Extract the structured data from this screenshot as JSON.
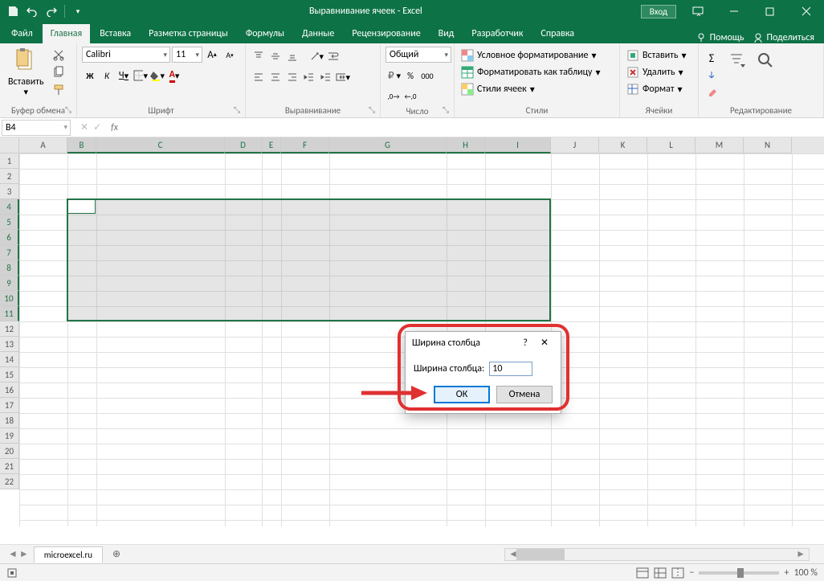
{
  "titlebar": {
    "title": "Выравнивание ячеек - Excel",
    "account": "Вход"
  },
  "tabs": {
    "file": "Файл",
    "home": "Главная",
    "insert": "Вставка",
    "layout": "Разметка страницы",
    "formulas": "Формулы",
    "data": "Данные",
    "review": "Рецензирование",
    "view": "Вид",
    "developer": "Разработчик",
    "help": "Справка",
    "tell": "Помощь",
    "share": "Поделиться"
  },
  "ribbon": {
    "clipboard": {
      "label": "Буфер обмена",
      "paste": "Вставить"
    },
    "font": {
      "label": "Шрифт",
      "family": "Calibri",
      "size": "11",
      "bold": "Ж",
      "italic": "К",
      "underline": "Ч"
    },
    "align": {
      "label": "Выравнивание"
    },
    "number": {
      "label": "Число",
      "format": "Общий"
    },
    "styles": {
      "label": "Стили",
      "cond": "Условное форматирование",
      "table": "Форматировать как таблицу",
      "cell": "Стили ячеек"
    },
    "cells": {
      "label": "Ячейки",
      "insert": "Вставить",
      "delete": "Удалить",
      "format": "Формат"
    },
    "editing": {
      "label": "Редактирование"
    }
  },
  "namebox": "B4",
  "columns": [
    {
      "l": "A",
      "w": 60,
      "sel": false
    },
    {
      "l": "B",
      "w": 36,
      "sel": true
    },
    {
      "l": "C",
      "w": 160,
      "sel": true
    },
    {
      "l": "D",
      "w": 46,
      "sel": true
    },
    {
      "l": "E",
      "w": 24,
      "sel": true
    },
    {
      "l": "F",
      "w": 60,
      "sel": true
    },
    {
      "l": "G",
      "w": 146,
      "sel": true
    },
    {
      "l": "H",
      "w": 48,
      "sel": true
    },
    {
      "l": "I",
      "w": 82,
      "sel": true
    },
    {
      "l": "J",
      "w": 60,
      "sel": false
    },
    {
      "l": "K",
      "w": 60,
      "sel": false
    },
    {
      "l": "L",
      "w": 60,
      "sel": false
    },
    {
      "l": "M",
      "w": 60,
      "sel": false
    },
    {
      "l": "N",
      "w": 60,
      "sel": false
    }
  ],
  "rows": {
    "count": 22,
    "sel_from": 4,
    "sel_to": 11
  },
  "selection": {
    "cell": "B4",
    "range": "B4:I11"
  },
  "dialog": {
    "title": "Ширина столбца",
    "field": "Ширина столбца:",
    "value": "10",
    "ok": "ОК",
    "cancel": "Отмена",
    "help": "?",
    "close": "✕"
  },
  "sheets": {
    "name": "microexcel.ru"
  },
  "status": {
    "zoom": "100 %",
    "plus": "+",
    "minus": "−"
  }
}
